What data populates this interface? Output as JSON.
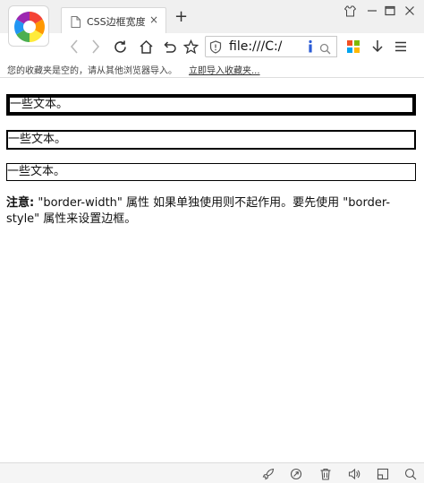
{
  "window": {
    "tab_title": "CSS边框宽度",
    "tab_close": "×",
    "new_tab": "+"
  },
  "toolbar": {
    "url": "file:///C:/"
  },
  "bookmarks": {
    "empty_text": "您的收藏夹是空的，请从其他浏览器导入。",
    "import_link": "立即导入收藏夹..."
  },
  "page": {
    "box_thick_text": "一些文本。",
    "box_medium_text": "一些文本。",
    "box_thin_text": "一些文本。",
    "note_label": "注意:",
    "note_text": " \"border-width\" 属性 如果单独使用则不起作用。要先使用 \"border-style\" 属性来设置边框。",
    "border_widths": [
      "thick",
      "medium",
      "thin"
    ]
  },
  "colors": {
    "chrome_bg": "#f0f0f0",
    "border": "#000000"
  }
}
